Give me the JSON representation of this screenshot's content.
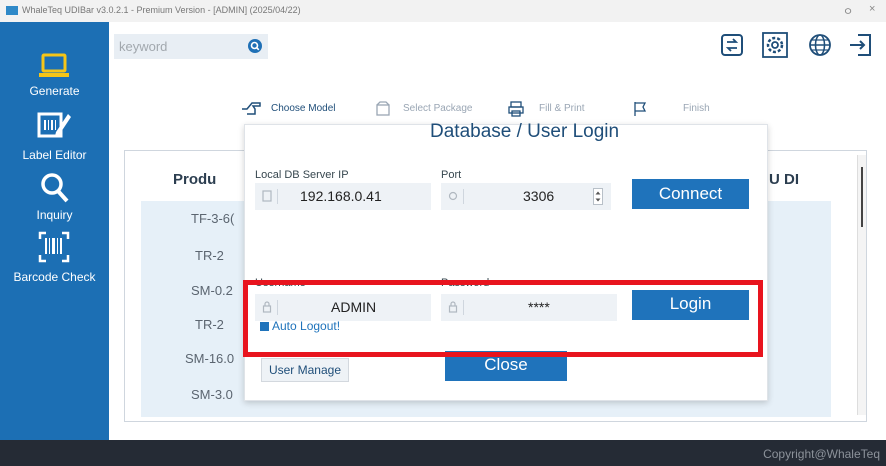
{
  "titlebar": {
    "text": "WhaleTeq UDIBar v3.0.2.1 - Premium Version - [ADMIN] (2025/04/22)",
    "minimize": "ㅇ",
    "close": "×"
  },
  "sidebar": {
    "items": [
      {
        "label": "Generate",
        "icon": "monitor-icon"
      },
      {
        "label": "Label Editor",
        "icon": "label-edit-icon"
      },
      {
        "label": "Inquiry",
        "icon": "magnifier-icon"
      },
      {
        "label": "Barcode Check",
        "icon": "barcode-scan-icon"
      }
    ]
  },
  "search": {
    "placeholder": "keyword"
  },
  "toolbar": {
    "icons": [
      "data-transfer-icon",
      "gear-icon",
      "globe-icon",
      "logout-icon"
    ]
  },
  "steps": [
    "Choose Model",
    "Select Package",
    "Fill & Print",
    "Finish"
  ],
  "table": {
    "columns": [
      "Produ",
      "U DI"
    ],
    "rows": [
      "TF-3-6(",
      "TR-2",
      "SM-0.2",
      "TR-2",
      "SM-16.0",
      "SM-3.0"
    ]
  },
  "dialog": {
    "title": "Database / User Login",
    "db_label": "Local DB Server IP",
    "db_value": "192.168.0.41",
    "port_label": "Port",
    "port_value": "3306",
    "connect_label": "Connect",
    "username_label": "Username",
    "username_value": "ADMIN",
    "password_label": "Password",
    "password_value": "****",
    "login_label": "Login",
    "auto_logout_label": "Auto Logout!",
    "auto_logout_checked": true,
    "user_manage_label": "User Manage",
    "close_label": "Close"
  },
  "footer": {
    "copyright": "Copyright@WhaleTeq"
  },
  "colors": {
    "sidebar": "#1c6fb4",
    "accent": "#1f73bb",
    "highlight": "#e8141e",
    "footer": "#252b35"
  }
}
